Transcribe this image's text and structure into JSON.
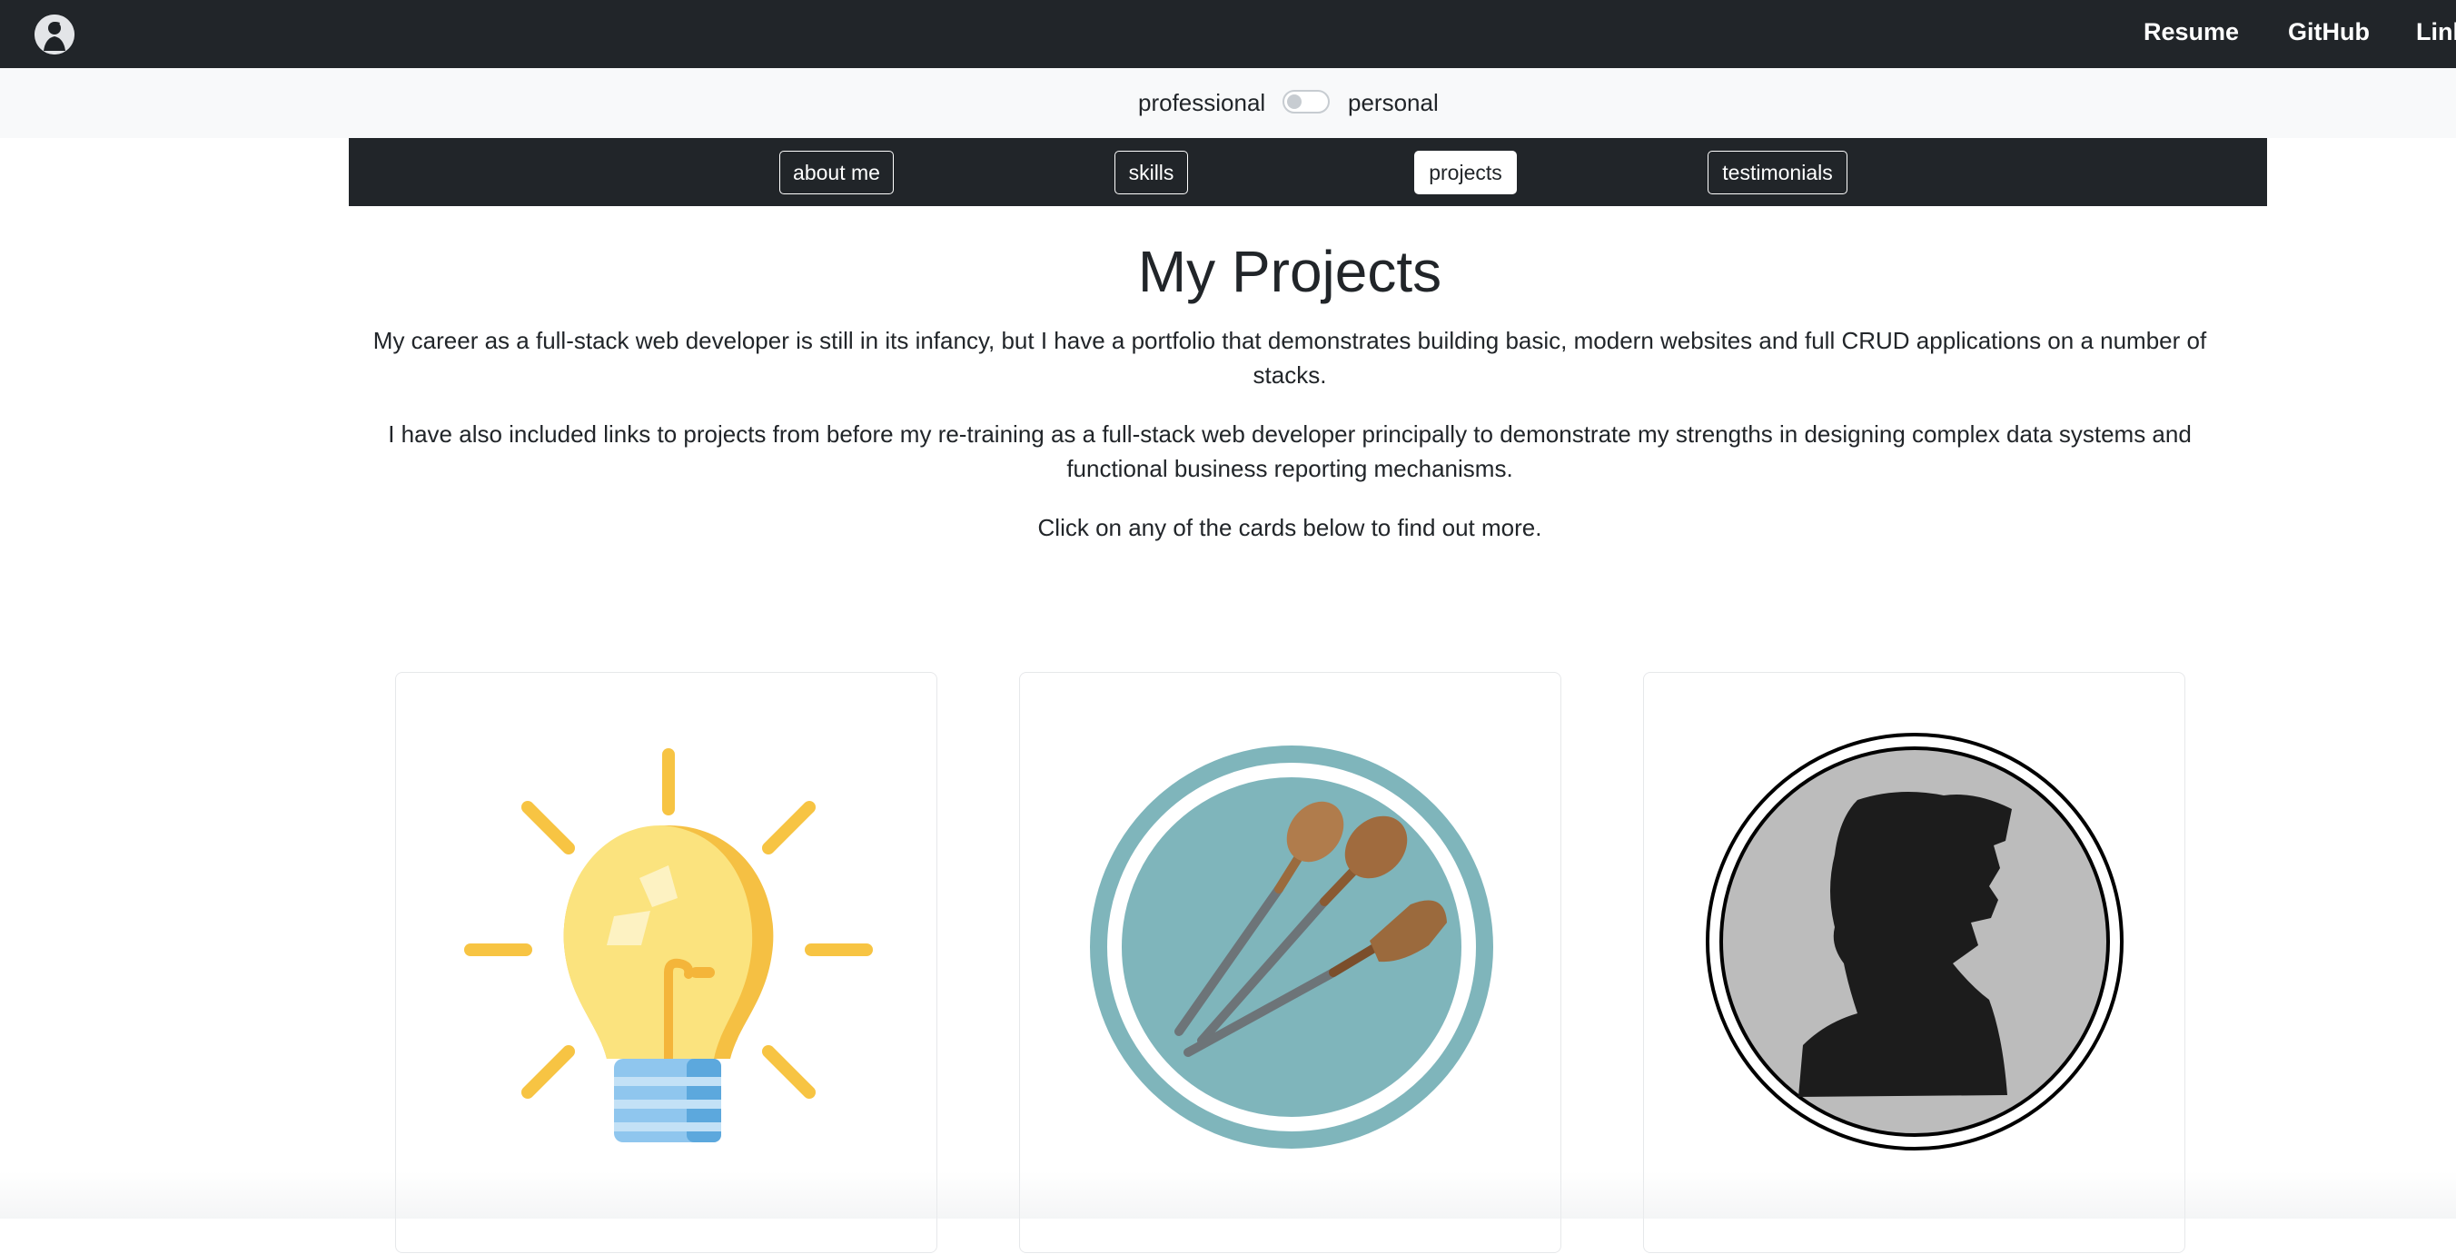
{
  "topnav": {
    "links": [
      "Resume",
      "GitHub",
      "LinkedIn"
    ]
  },
  "mode_toggle": {
    "left_label": "professional",
    "right_label": "personal",
    "is_on": false
  },
  "section_nav": {
    "buttons": [
      "about me",
      "skills",
      "projects",
      "testimonials"
    ],
    "active": "projects"
  },
  "main": {
    "title": "My Projects",
    "paragraphs": [
      "My career as a full-stack web developer is still in its infancy, but I have a portfolio that demonstrates building basic, modern websites and full CRUD applications on a number of stacks.",
      "I have also included links to projects from before my re-training as a full-stack web developer principally to demonstrate my strengths in designing complex data systems and functional business reporting mechanisms.",
      "Click on any of the cards below to find out more."
    ]
  },
  "cards": [
    {
      "icon": "lightbulb-icon"
    },
    {
      "icon": "wooden-spoons-icon"
    },
    {
      "icon": "silhouette-portrait-icon"
    }
  ],
  "colors": {
    "navbar": "#212529",
    "toggle_strip": "#f8f9fa",
    "bulb_yellow": "#f7c443",
    "spoon_teal": "#7fb5bb",
    "portrait_grey": "#bcbcbc"
  }
}
